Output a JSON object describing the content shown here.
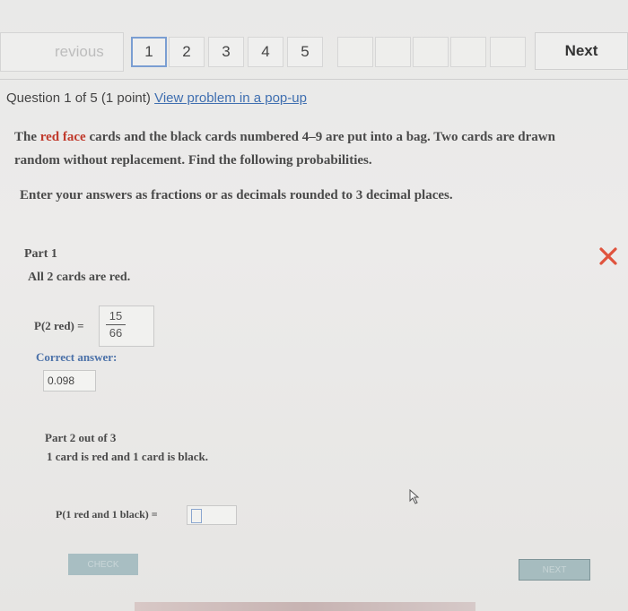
{
  "nav": {
    "previous_label": "revious",
    "pages": [
      "1",
      "2",
      "3",
      "4",
      "5"
    ],
    "current_page": "1",
    "next_label": "Next"
  },
  "question": {
    "header": "Question 1 of 5 (1 point)",
    "popup_link": "View problem in a pop-up",
    "statement_pre": "The",
    "statement_red": "red face",
    "statement_post": "cards and the black cards numbered 4–9 are put into a bag. Two cards are drawn",
    "statement_line2": "random without replacement. Find the following probabilities.",
    "instructions": "Enter your answers as fractions or as decimals rounded to 3 decimal places."
  },
  "part1": {
    "title": "Part 1",
    "description": "All 2 cards are red.",
    "answer_label": "P(2 red) =",
    "answer_numerator": "15",
    "answer_denominator": "66",
    "correct_label": "Correct answer:",
    "correct_value": "0.098",
    "status_icon": "x-mark-icon",
    "status_color": "#e0533d"
  },
  "part2": {
    "title": "Part 2 out of 3",
    "description": "1 card is red and 1 card is black.",
    "answer_label": "P(1 red and 1 black) ="
  },
  "actions": {
    "check_label": "CHECK",
    "next_label": "NEXT"
  }
}
